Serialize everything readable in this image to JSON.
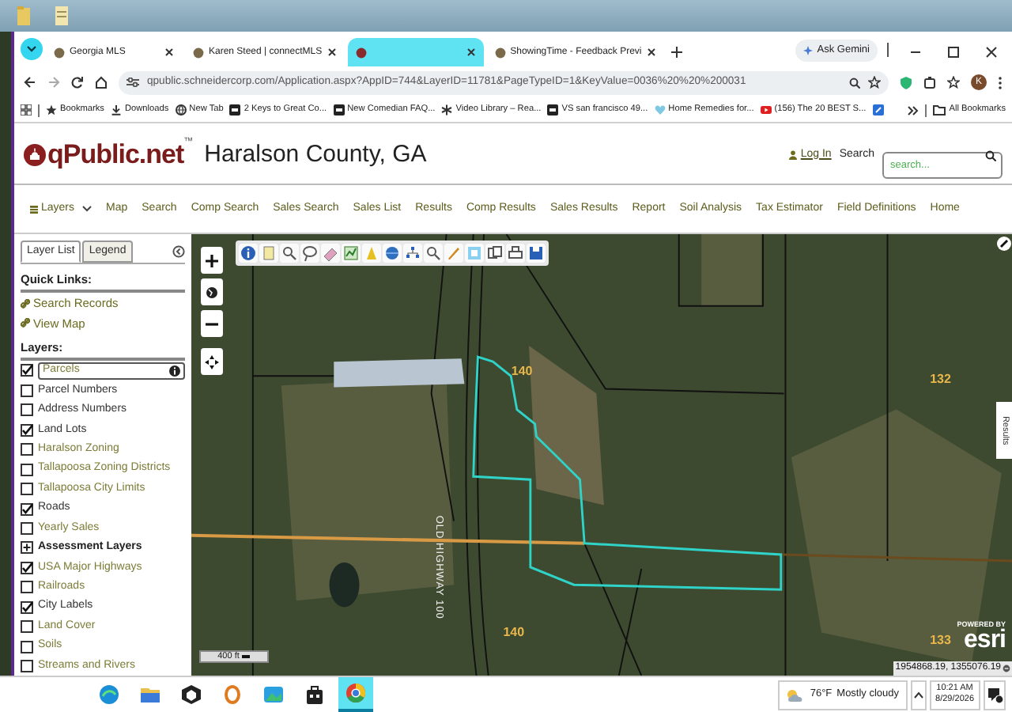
{
  "browser": {
    "tabs": [
      {
        "title": "Georgia MLS",
        "selected": false
      },
      {
        "title": "Karen Steed | connectMLS",
        "selected": false
      },
      {
        "selected": true
      },
      {
        "title": "ShowingTime - Feedback Previ",
        "selected": false
      }
    ],
    "ask_gemini": "Ask Gemini",
    "address_bar": {
      "url": "qpublic.schneidercorp.com/Application.aspx?AppID=744&LayerID=11781&PageTypeID=1&KeyValue=0036%20%20%200031"
    },
    "profile_initial": "K",
    "bookmarks": [
      {
        "kind": "star",
        "label": "Bookmarks"
      },
      {
        "kind": "download",
        "label": "Downloads"
      },
      {
        "kind": "globe",
        "label": "New Tab"
      },
      {
        "kind": "tile",
        "label": "2 Keys to Great Co..."
      },
      {
        "kind": "tile",
        "label": "New Comedian FAQ..."
      },
      {
        "kind": "burst",
        "label": "Video Library – Rea..."
      },
      {
        "kind": "tile",
        "label": "VS san francisco 49..."
      },
      {
        "kind": "heart",
        "label": "Home Remedies for..."
      },
      {
        "kind": "video",
        "label": "(156) The 20 BEST S..."
      }
    ],
    "all_bookmarks": "All Bookmarks"
  },
  "site": {
    "logo": "qPublic.net",
    "trademark": "™",
    "county": "Haralson County, GA",
    "login": "Log In",
    "search_label": "Search",
    "search": {
      "placeholder": "search..."
    }
  },
  "nav": [
    "Layers",
    "Map",
    "Search",
    "Comp Search",
    "Sales Search",
    "Sales List",
    "Results",
    "Comp Results",
    "Sales Results",
    "Report",
    "Soil Analysis",
    "Tax Estimator",
    "Field Definitions",
    "Home"
  ],
  "panel": {
    "tabs": [
      {
        "label": "Layer List",
        "selected": true
      },
      {
        "label": "Legend",
        "selected": false
      }
    ],
    "quick_links_heading": "Quick Links:",
    "quick_links": [
      "Search Records",
      "View Map"
    ],
    "layers_heading": "Layers:",
    "layers": [
      {
        "kind": "layer",
        "label": "Parcels",
        "checked": true,
        "dimmed": true,
        "selected": true
      },
      {
        "kind": "layer",
        "label": "Parcel Numbers",
        "checked": false,
        "dimmed": false,
        "selected": false
      },
      {
        "kind": "layer",
        "label": "Address Numbers",
        "checked": false,
        "dimmed": false,
        "selected": false
      },
      {
        "kind": "layer",
        "label": "Land Lots",
        "checked": true,
        "dimmed": false,
        "selected": false
      },
      {
        "kind": "layer",
        "label": "Haralson Zoning",
        "checked": false,
        "dimmed": true,
        "selected": false
      },
      {
        "kind": "layer",
        "label": "Tallapoosa Zoning Districts",
        "checked": false,
        "dimmed": true,
        "selected": false
      },
      {
        "kind": "layer",
        "label": "Tallapoosa City Limits",
        "checked": false,
        "dimmed": true,
        "selected": false
      },
      {
        "kind": "layer",
        "label": "Roads",
        "checked": true,
        "dimmed": false,
        "selected": false
      },
      {
        "kind": "layer",
        "label": "Yearly Sales",
        "checked": false,
        "dimmed": true,
        "selected": false
      },
      {
        "kind": "group",
        "label": "Assessment Layers",
        "expanded": false
      },
      {
        "kind": "layer",
        "label": "USA Major Highways",
        "checked": true,
        "dimmed": true,
        "selected": false
      },
      {
        "kind": "layer",
        "label": "Railroads",
        "checked": false,
        "dimmed": true,
        "selected": false
      },
      {
        "kind": "layer",
        "label": "City Labels",
        "checked": true,
        "dimmed": false,
        "selected": false
      },
      {
        "kind": "layer",
        "label": "Land Cover",
        "checked": false,
        "dimmed": true,
        "selected": false
      },
      {
        "kind": "layer",
        "label": "Soils",
        "checked": false,
        "dimmed": true,
        "selected": false
      },
      {
        "kind": "layer",
        "label": "Streams and Rivers",
        "checked": false,
        "dimmed": true,
        "selected": false
      }
    ]
  },
  "map": {
    "labels": [
      "140",
      "132",
      "140",
      "133"
    ],
    "road_label": "OLD HIGHWAY 100",
    "scale": "400 ft",
    "esri_caption": "POWERED BY",
    "esri": "esri",
    "coordinates": "1954868.19, 1355076.19",
    "results_tab": "Results"
  },
  "taskbar": {
    "apps": [
      {
        "kind": "wave",
        "selected": false
      },
      {
        "kind": "folder",
        "selected": false
      },
      {
        "kind": "cube",
        "selected": false
      },
      {
        "kind": "badge",
        "selected": false
      },
      {
        "kind": "gallery",
        "selected": false
      },
      {
        "kind": "bag",
        "selected": false
      },
      {
        "kind": "ring",
        "selected": true
      }
    ],
    "weather": {
      "temperature": "76°F",
      "condition": "Mostly cloudy"
    },
    "time": "10:21 AM",
    "date": "8/29/2026"
  }
}
